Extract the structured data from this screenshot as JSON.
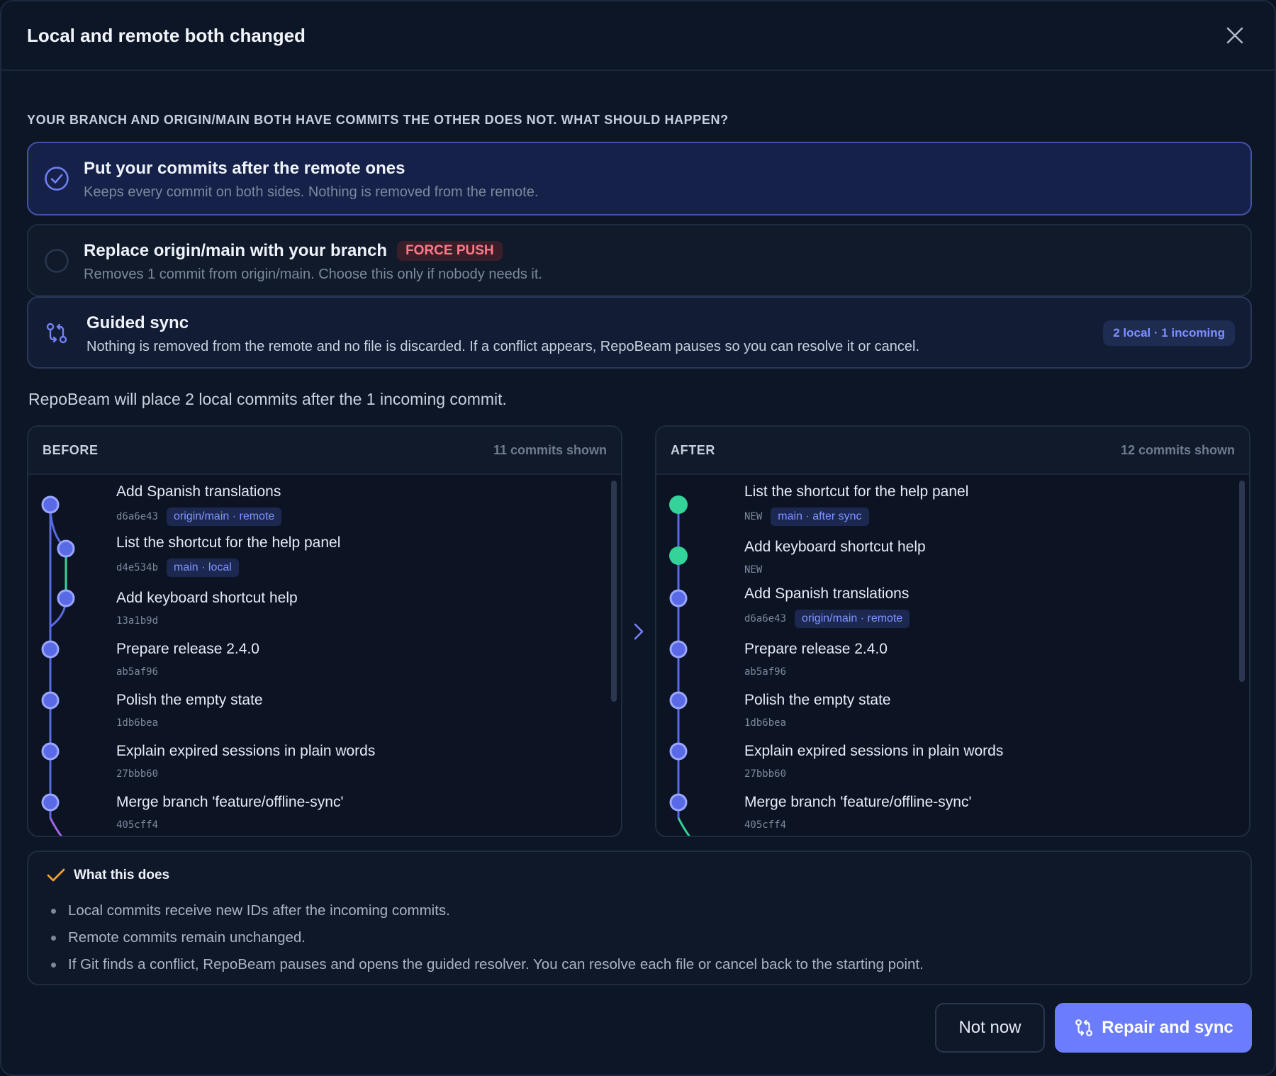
{
  "dialog": {
    "title": "Local and remote both changed",
    "close_icon": "close-icon"
  },
  "question": "YOUR BRANCH AND ORIGIN/MAIN BOTH HAVE COMMITS THE OTHER DOES NOT. WHAT SHOULD HAPPEN?",
  "options": [
    {
      "title": "Put your commits after the remote ones",
      "desc": "Keeps every commit on both sides. Nothing is removed from the remote.",
      "selected": true
    },
    {
      "title": "Replace origin/main with your branch",
      "badge": "FORCE PUSH",
      "desc": "Removes 1 commit from origin/main. Choose this only if nobody needs it.",
      "selected": false
    }
  ],
  "guided": {
    "title": "Guided sync",
    "desc": "Nothing is removed from the remote and no file is discarded. If a conflict appears, RepoBeam pauses so you can resolve it or cancel.",
    "badge": "2 local · 1 incoming",
    "icon": "sync-branches-icon"
  },
  "summary": "RepoBeam will place 2 local commits after the 1 incoming commit.",
  "before": {
    "title": "BEFORE",
    "count": "11 commits shown",
    "commits": [
      {
        "msg": "Add Spanish translations",
        "hash": "d6a6e43",
        "tag": "origin/main · remote"
      },
      {
        "msg": "List the shortcut for the help panel",
        "hash": "d4e534b",
        "tag": "main · local"
      },
      {
        "msg": "Add keyboard shortcut help",
        "hash": "13a1b9d",
        "tag": ""
      },
      {
        "msg": "Prepare release 2.4.0",
        "hash": "ab5af96",
        "tag": ""
      },
      {
        "msg": "Polish the empty state",
        "hash": "1db6bea",
        "tag": ""
      },
      {
        "msg": "Explain expired sessions in plain words",
        "hash": "27bbb60",
        "tag": ""
      },
      {
        "msg": "Merge branch 'feature/offline-sync'",
        "hash": "405cff4",
        "tag": ""
      }
    ]
  },
  "after": {
    "title": "AFTER",
    "count": "12 commits shown",
    "commits": [
      {
        "msg": "List the shortcut for the help panel",
        "hash": "NEW",
        "tag": "main · after sync"
      },
      {
        "msg": "Add keyboard shortcut help",
        "hash": "NEW",
        "tag": ""
      },
      {
        "msg": "Add Spanish translations",
        "hash": "d6a6e43",
        "tag": "origin/main · remote"
      },
      {
        "msg": "Prepare release 2.4.0",
        "hash": "ab5af96",
        "tag": ""
      },
      {
        "msg": "Polish the empty state",
        "hash": "1db6bea",
        "tag": ""
      },
      {
        "msg": "Explain expired sessions in plain words",
        "hash": "27bbb60",
        "tag": ""
      },
      {
        "msg": "Merge branch 'feature/offline-sync'",
        "hash": "405cff4",
        "tag": ""
      }
    ]
  },
  "info": {
    "title": "What this does",
    "items": [
      "Local commits receive new IDs after the incoming commits.",
      "Remote commits remain unchanged.",
      "If Git finds a conflict, RepoBeam pauses and opens the guided resolver. You can resolve each file or cancel back to the starting point."
    ]
  },
  "buttons": {
    "cancel": "Not now",
    "confirm": "Repair and sync"
  },
  "colors": {
    "accent": "#6b7dfd",
    "node_blue": "#6b7dfd",
    "node_new": "#34d399",
    "danger": "#ff7a86"
  }
}
